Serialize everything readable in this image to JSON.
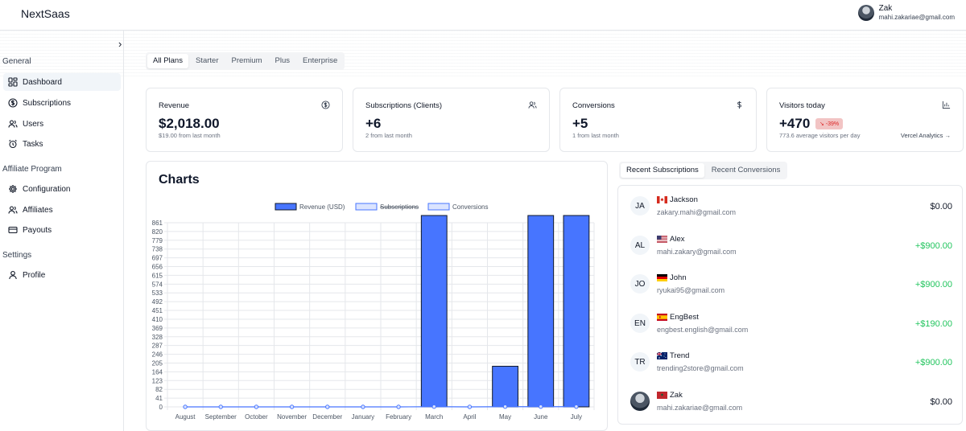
{
  "app": {
    "title": "NextSaas"
  },
  "user": {
    "name": "Zak",
    "email": "mahi.zakariae@gmail.com"
  },
  "sidebar": {
    "sections": [
      {
        "label": "General",
        "items": [
          {
            "label": "Dashboard",
            "icon": "dashboard-icon",
            "active": true
          },
          {
            "label": "Subscriptions",
            "icon": "dollar-circle-icon"
          },
          {
            "label": "Users",
            "icon": "users-icon"
          },
          {
            "label": "Tasks",
            "icon": "alarm-clock-icon"
          }
        ]
      },
      {
        "label": "Affiliate Program",
        "items": [
          {
            "label": "Configuration",
            "icon": "gear-icon"
          },
          {
            "label": "Affiliates",
            "icon": "users-icon"
          },
          {
            "label": "Payouts",
            "icon": "credit-card-icon"
          }
        ]
      },
      {
        "label": "Settings",
        "items": [
          {
            "label": "Profile",
            "icon": "user-icon"
          }
        ]
      }
    ]
  },
  "plan_tabs": [
    "All Plans",
    "Starter",
    "Premium",
    "Plus",
    "Enterprise"
  ],
  "stats": [
    {
      "title": "Revenue",
      "value": "$2,018.00",
      "sub": "$19.00 from last month",
      "icon": "dollar-circle-icon"
    },
    {
      "title": "Subscriptions (Clients)",
      "value": "+6",
      "sub": "2 from last month",
      "icon": "users-icon"
    },
    {
      "title": "Conversions",
      "value": "+5",
      "sub": "1 from last month",
      "icon": "dollar-icon"
    },
    {
      "title": "Visitors today",
      "value": "+470",
      "sub": "773.6 average visitors per day",
      "badge": "↘ -39%",
      "link": "Vercel Analytics →",
      "icon": "bar-chart-icon"
    }
  ],
  "charts": {
    "title": "Charts"
  },
  "chart_data": {
    "type": "bar",
    "categories": [
      "August",
      "September",
      "October",
      "November",
      "December",
      "January",
      "February",
      "March",
      "April",
      "May",
      "June",
      "July"
    ],
    "series": [
      {
        "name": "Revenue (USD)",
        "type": "bar",
        "values": [
          0,
          0,
          0,
          0,
          0,
          0,
          0,
          900,
          0,
          190,
          900,
          900
        ]
      },
      {
        "name": "Subscriptions",
        "type": "line",
        "hidden": true,
        "values": [
          0,
          0,
          0,
          0,
          0,
          0,
          0,
          1,
          0,
          1,
          1,
          1
        ]
      },
      {
        "name": "Conversions",
        "type": "line",
        "values": [
          0,
          0,
          0,
          0,
          0,
          0,
          0,
          1,
          0,
          1,
          1,
          1
        ]
      }
    ],
    "ylim": [
      0,
      861
    ],
    "yticks": [
      "861",
      "820",
      "779",
      "738",
      "697",
      "656",
      "615",
      "574",
      "533",
      "492",
      "451",
      "410",
      "369",
      "328",
      "287",
      "246",
      "205",
      "164",
      "123",
      "82",
      "41",
      "0"
    ],
    "legend": "top",
    "grid": true,
    "colors": {
      "bar": "#4775ff",
      "line": "#4775ff"
    }
  },
  "recent_tabs": [
    "Recent Subscriptions",
    "Recent Conversions"
  ],
  "recent": [
    {
      "initials": "JA",
      "name": "Jackson",
      "email": "zakary.mahi@gmail.com",
      "amount": "$0.00",
      "flag": "ca"
    },
    {
      "initials": "AL",
      "name": "Alex",
      "email": "mahi.zakary@gmail.com",
      "amount": "+$900.00",
      "flag": "us"
    },
    {
      "initials": "JO",
      "name": "John",
      "email": "ryukai95@gmail.com",
      "amount": "+$900.00",
      "flag": "de"
    },
    {
      "initials": "EN",
      "name": "EngBest",
      "email": "engbest.english@gmail.com",
      "amount": "+$190.00",
      "flag": "es"
    },
    {
      "initials": "TR",
      "name": "Trend",
      "email": "trending2store@gmail.com",
      "amount": "+$900.00",
      "flag": "au"
    },
    {
      "initials": "",
      "name": "Zak",
      "email": "mahi.zakariae@gmail.com",
      "amount": "$0.00",
      "flag": "ma",
      "photo": true
    }
  ]
}
